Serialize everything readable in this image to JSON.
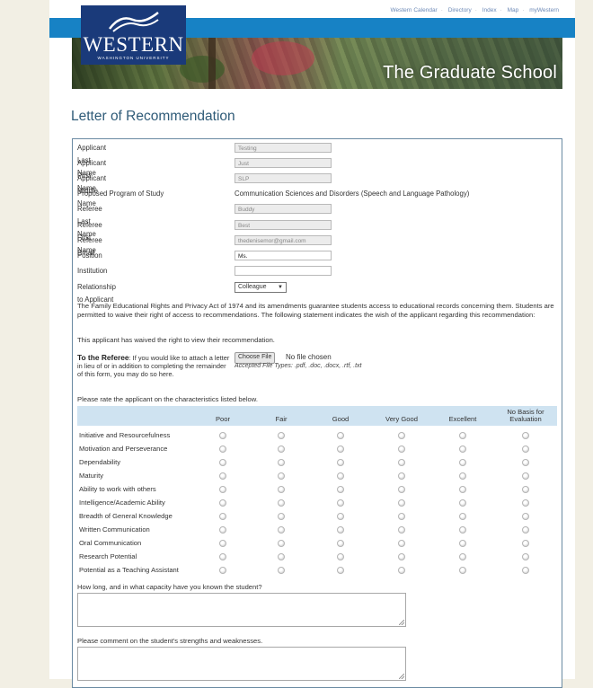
{
  "topnav": [
    "Western Calendar",
    "Directory",
    "Index",
    "Map",
    "myWestern"
  ],
  "logo": {
    "name": "WESTERN",
    "sub": "WASHINGTON UNIVERSITY"
  },
  "banner_title": "The Graduate School",
  "page_title": "Letter of Recommendation",
  "fields": [
    {
      "label": "Applicant Last Name",
      "value": "Testing",
      "kind": "readonly"
    },
    {
      "label": "Applicant First Name",
      "value": "Just",
      "kind": "readonly"
    },
    {
      "label": "Applicant Middle Name",
      "value": "SLP",
      "kind": "readonly"
    },
    {
      "label": "Proposed Program of Study",
      "value": "Communication Sciences and Disorders (Speech and Language Pathology)",
      "kind": "text"
    },
    {
      "label": "Referee Last Name",
      "value": "Buddy",
      "kind": "readonly"
    },
    {
      "label": "Referee First Name",
      "value": "Best",
      "kind": "readonly"
    },
    {
      "label": "Referee Email",
      "value": "thedenisemor@gmail.com",
      "kind": "readonly"
    },
    {
      "label": "Position",
      "value": "Ms.",
      "kind": "editable"
    },
    {
      "label": "Institution",
      "value": "",
      "kind": "editable"
    },
    {
      "label": "Relationship to Applicant",
      "value": "Colleague",
      "kind": "select"
    }
  ],
  "ferpa_text": "The Family Educational Rights and Privacy Act of 1974 and its amendments guarantee students access to educational records concerning them. Students are permitted to waive their right of access to recommendations. The following statement indicates the wish of the applicant regarding this recommendation:",
  "waiver_text": "This applicant has waived the right to view their recommendation.",
  "referee": {
    "title": "To the Referee",
    "text": ": If you would like to attach a letter in lieu of or in addition to completing the remainder of this form, you may do so here.",
    "button": "Choose File",
    "no_file": "No file chosen",
    "accepted": "Accepted File Types: .pdf, .doc, .docx, .rtf, .txt"
  },
  "rating_prompt": "Please rate the applicant on the characteristics listed below.",
  "rating_columns": [
    "Poor",
    "Fair",
    "Good",
    "Very Good",
    "Excellent",
    "No Basis for Evaluation"
  ],
  "rating_rows": [
    "Initiative and Resourcefulness",
    "Motivation and Perseverance",
    "Dependability",
    "Maturity",
    "Ability to work with others",
    "Intelligence/Academic Ability",
    "Breadth of General Knowledge",
    "Written Communication",
    "Oral Communication",
    "Research Potential",
    "Potential as a Teaching Assistant"
  ],
  "questions": [
    "How long, and in what capacity have you known the student?",
    "Please comment on the student's strengths and weaknesses."
  ]
}
